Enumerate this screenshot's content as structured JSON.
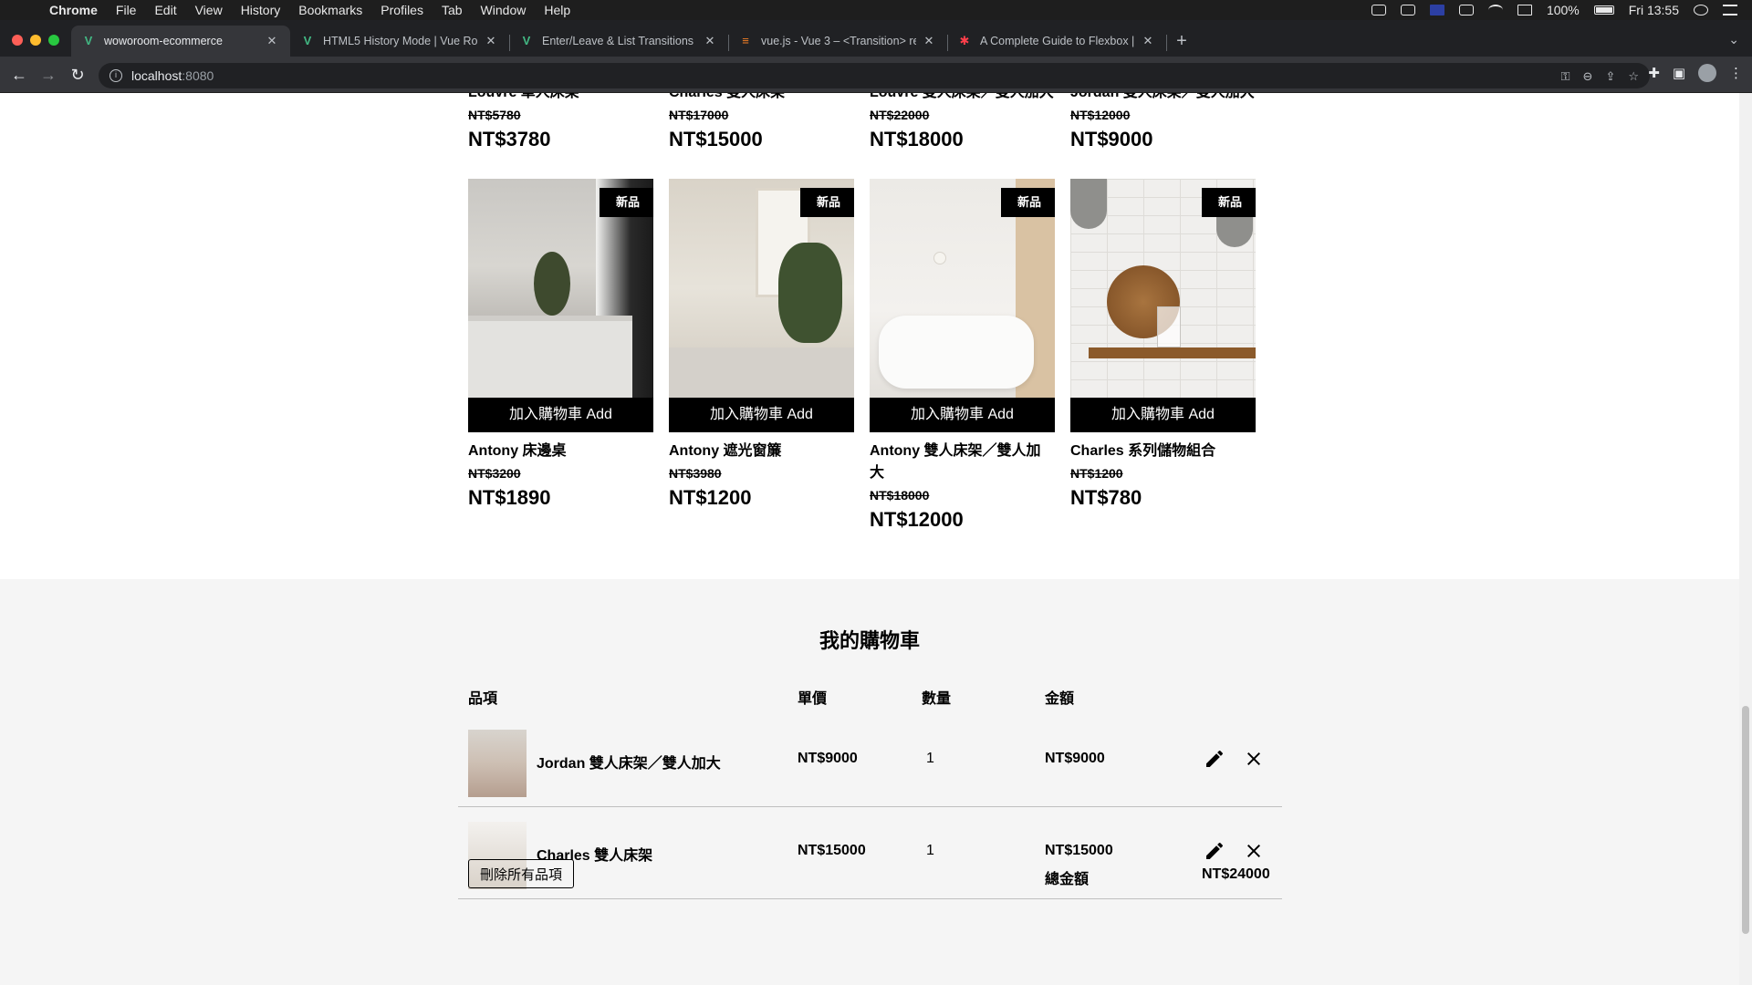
{
  "menubar": {
    "app": "Chrome",
    "items": [
      "File",
      "Edit",
      "View",
      "History",
      "Bookmarks",
      "Profiles",
      "Tab",
      "Window",
      "Help"
    ],
    "battery": "100%",
    "clock": "Fri 13:55"
  },
  "tabs": [
    {
      "title": "woworoom-ecommerce",
      "icon": "vue-icon"
    },
    {
      "title": "HTML5 History Mode | Vue Ro",
      "icon": "vue-icon"
    },
    {
      "title": "Enter/Leave & List Transitions",
      "icon": "vue-icon"
    },
    {
      "title": "vue.js - Vue 3 – <Transition> re",
      "icon": "stackoverflow-icon"
    },
    {
      "title": "A Complete Guide to Flexbox |",
      "icon": "css-tricks-icon"
    }
  ],
  "address": {
    "host": "localhost",
    "port": ":8080"
  },
  "products_top": [
    {
      "name": "Louvre 單人床架",
      "orig": "NT$5780",
      "price": "NT$3780"
    },
    {
      "name": "Charles 雙人床架",
      "orig": "NT$17000",
      "price": "NT$15000"
    },
    {
      "name": "Louvre 雙人床架／雙人加大",
      "orig": "NT$22000",
      "price": "NT$18000"
    },
    {
      "name": "Jordan 雙人床架／雙人加大",
      "orig": "NT$12000",
      "price": "NT$9000"
    }
  ],
  "products": [
    {
      "badge": "新品",
      "button": "加入購物車 Add",
      "name": "Antony 床邊桌",
      "orig": "NT$3200",
      "price": "NT$1890"
    },
    {
      "badge": "新品",
      "button": "加入購物車 Add",
      "name": "Antony 遮光窗簾",
      "orig": "NT$3980",
      "price": "NT$1200"
    },
    {
      "badge": "新品",
      "button": "加入購物車 Add",
      "name": "Antony 雙人床架／雙人加大",
      "orig": "NT$18000",
      "price": "NT$12000"
    },
    {
      "badge": "新品",
      "button": "加入購物車 Add",
      "name": "Charles 系列儲物組合",
      "orig": "NT$1200",
      "price": "NT$780"
    }
  ],
  "cart": {
    "title": "我的購物車",
    "headers": {
      "item": "品項",
      "price": "單價",
      "qty": "數量",
      "subtotal": "金額"
    },
    "rows": [
      {
        "name": "Jordan 雙人床架／雙人加大",
        "price": "NT$9000",
        "qty": "1",
        "subtotal": "NT$9000"
      },
      {
        "name": "Charles 雙人床架",
        "price": "NT$15000",
        "qty": "1",
        "subtotal": "NT$15000"
      }
    ],
    "clear_label": "刪除所有品項",
    "total_label": "總金額",
    "total_value": "NT$24000"
  }
}
